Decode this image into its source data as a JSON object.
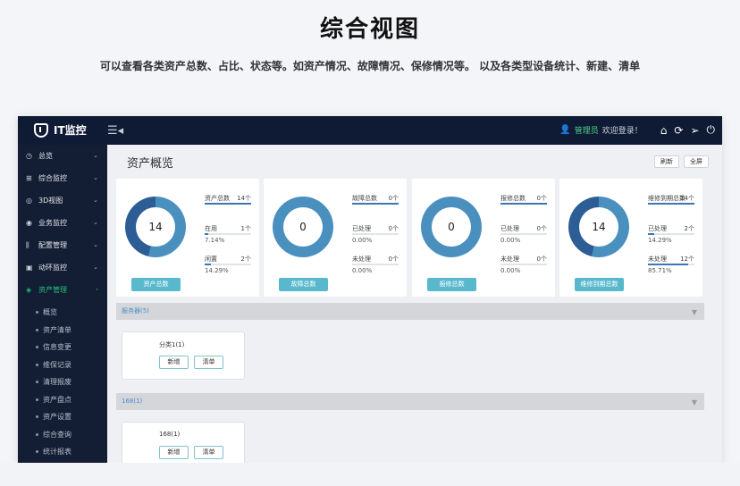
{
  "hero": {
    "title": "综合视图",
    "subtitle": "可以查看各类资产总数、占比、状态等。如资产情况、故障情况、保修情况等。 以及各类型设备统计、新建、清单"
  },
  "topbar": {
    "brand": "IT监控",
    "user": "管理员",
    "welcome": "欢迎登录！",
    "icons": [
      "menu-toggle-icon",
      "user-icon",
      "home-icon",
      "refresh-icon",
      "send-icon",
      "power-icon"
    ]
  },
  "sidebar": {
    "items": [
      {
        "label": "总览",
        "icon": "clock-icon",
        "glyph": "◷"
      },
      {
        "label": "综合监控",
        "icon": "monitor-plus-icon",
        "glyph": "⊞"
      },
      {
        "label": "3D视图",
        "icon": "cube-icon",
        "glyph": "◎"
      },
      {
        "label": "业务监控",
        "icon": "business-icon",
        "glyph": "◉"
      },
      {
        "label": "配置管理",
        "icon": "sliders-icon",
        "glyph": "⫼"
      },
      {
        "label": "动环监控",
        "icon": "screen-icon",
        "glyph": "▣"
      },
      {
        "label": "资产管理",
        "icon": "layers-icon",
        "glyph": "◈"
      }
    ],
    "active_index": 6,
    "sub_items": [
      "概览",
      "资产清单",
      "信息变更",
      "维保记录",
      "清理报废",
      "资产盘点",
      "资产设置",
      "综合查询",
      "统计报表"
    ]
  },
  "main": {
    "title": "资产概览",
    "refresh_label": "刷新",
    "fullscreen_label": "全屏"
  },
  "cards": [
    {
      "center": "14",
      "button": "资产总数",
      "donut": [
        {
          "value": 14,
          "color": "#4a90bf"
        },
        {
          "value": 12,
          "color": "#2c5e95"
        }
      ],
      "stats": [
        {
          "label": "资产总数",
          "count": "14个",
          "percent": "",
          "fill": 1.0
        },
        {
          "label": "在用",
          "count": "1个",
          "percent": "7.14%",
          "fill": 0.0714
        },
        {
          "label": "闲置",
          "count": "2个",
          "percent": "14.29%",
          "fill": 0.1429
        }
      ]
    },
    {
      "center": "0",
      "button": "故障总数",
      "donut": [
        {
          "value": 1,
          "color": "#4a90bf"
        }
      ],
      "stats": [
        {
          "label": "故障总数",
          "count": "0个",
          "percent": "",
          "fill": 1.0
        },
        {
          "label": "已处理",
          "count": "0个",
          "percent": "0.00%",
          "fill": 0
        },
        {
          "label": "未处理",
          "count": "0个",
          "percent": "0.00%",
          "fill": 0
        }
      ]
    },
    {
      "center": "0",
      "button": "报修总数",
      "donut": [
        {
          "value": 1,
          "color": "#4a90bf"
        }
      ],
      "stats": [
        {
          "label": "报修总数",
          "count": "0个",
          "percent": "",
          "fill": 1.0
        },
        {
          "label": "已处理",
          "count": "0个",
          "percent": "0.00%",
          "fill": 0
        },
        {
          "label": "未处理",
          "count": "0个",
          "percent": "0.00%",
          "fill": 0
        }
      ]
    },
    {
      "center": "14",
      "button": "维修到期总数",
      "donut": [
        {
          "value": 14,
          "color": "#4a90bf"
        },
        {
          "value": 12,
          "color": "#2c5e95"
        }
      ],
      "stats": [
        {
          "label": "维修到期总数",
          "count": "14个",
          "percent": "",
          "fill": 1.0
        },
        {
          "label": "已处理",
          "count": "2个",
          "percent": "14.29%",
          "fill": 0.1429
        },
        {
          "label": "未处理",
          "count": "12个",
          "percent": "85.71%",
          "fill": 0.8571
        }
      ]
    }
  ],
  "sections": [
    {
      "title": "服务器(5)",
      "category": "分类1(1)",
      "add_label": "新增",
      "clear_label": "清单"
    },
    {
      "title": "168(1)",
      "category": "168(1)",
      "add_label": "新增",
      "clear_label": "清单"
    }
  ]
}
